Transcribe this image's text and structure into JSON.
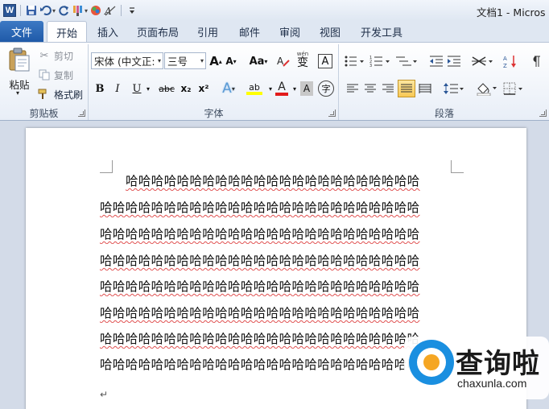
{
  "window": {
    "title": "文档1 - Micros"
  },
  "quick_access": {
    "word_logo": "W",
    "icons": [
      "save-icon",
      "undo-icon",
      "redo-icon",
      "format-painter-icon",
      "color-icon",
      "clear-format-icon",
      "customize-icon"
    ]
  },
  "tabs": [
    {
      "label": "文件",
      "active": false
    },
    {
      "label": "开始",
      "active": true
    },
    {
      "label": "插入",
      "active": false
    },
    {
      "label": "页面布局",
      "active": false
    },
    {
      "label": "引用",
      "active": false
    },
    {
      "label": "邮件",
      "active": false
    },
    {
      "label": "审阅",
      "active": false
    },
    {
      "label": "视图",
      "active": false
    },
    {
      "label": "开发工具",
      "active": false
    }
  ],
  "clipboard": {
    "group_label": "剪贴板",
    "paste_label": "粘贴",
    "cut_label": "剪切",
    "copy_label": "复制",
    "format_painter_label": "格式刷"
  },
  "font": {
    "group_label": "字体",
    "font_name": "宋体 (中文正:",
    "font_size": "三号",
    "grow_label": "A",
    "shrink_label": "A",
    "case_label": "Aa",
    "phonetic_label": "wén",
    "phonetic_char": "变",
    "border_char": "A",
    "bold": "B",
    "italic": "I",
    "underline": "U",
    "strikethrough": "abc",
    "subscript": "x₂",
    "superscript": "x²",
    "effects": "A",
    "highlight": "ab",
    "font_color": "A",
    "shading": "A",
    "enclose": "字"
  },
  "paragraph": {
    "group_label": "段落"
  },
  "document": {
    "lines": [
      "哈哈哈哈哈哈哈哈哈哈哈哈哈哈哈哈哈哈哈哈哈哈哈",
      "哈哈哈哈哈哈哈哈哈哈哈哈哈哈哈哈哈哈哈哈哈哈哈哈哈",
      "哈哈哈哈哈哈哈哈哈哈哈哈哈哈哈哈哈哈哈哈哈哈哈哈哈",
      "哈哈哈哈哈哈哈哈哈哈哈哈哈哈哈哈哈哈哈哈哈哈哈哈哈",
      "哈哈哈哈哈哈哈哈哈哈哈哈哈哈哈哈哈哈哈哈哈哈哈哈哈",
      "哈哈哈哈哈哈哈哈哈哈哈哈哈哈哈哈哈哈哈哈哈哈哈哈哈",
      "哈哈哈哈哈哈哈哈哈哈哈哈哈哈哈哈哈哈哈哈哈哈哈哈哈",
      "哈哈哈哈哈哈哈哈哈哈哈哈哈哈哈哈哈哈哈哈哈哈哈哈哈"
    ],
    "paragraph_mark": "↵"
  },
  "watermark": {
    "text": "查询啦",
    "url": "chaxunla.com"
  },
  "colors": {
    "accent": "#2b5797",
    "file_tab": "#1f5aa8",
    "squiggle": "#e05050",
    "watermark_blue": "#1a8fe0",
    "watermark_orange": "#f5a623"
  }
}
